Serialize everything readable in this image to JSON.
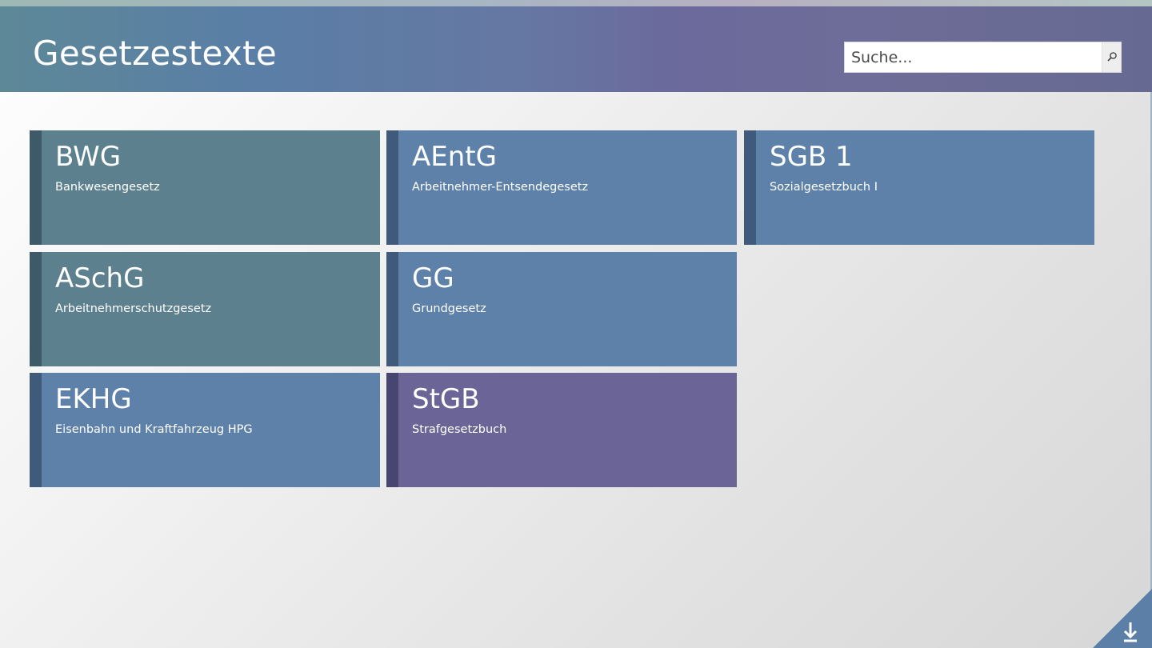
{
  "header": {
    "title": "Gesetzestexte",
    "search_placeholder": "Suche...",
    "search_icon": "magnifier-icon"
  },
  "tiles": [
    {
      "abbr": "BWG",
      "name": "Bankwesengesetz",
      "color": "teal"
    },
    {
      "abbr": "AEntG",
      "name": "Arbeitnehmer-Entsendegesetz",
      "color": "blue"
    },
    {
      "abbr": "SGB 1",
      "name": "Sozialgesetzbuch I",
      "color": "blue"
    },
    {
      "abbr": "ASchG",
      "name": "Arbeitnehmerschutzgesetz",
      "color": "teal"
    },
    {
      "abbr": "GG",
      "name": "Grundgesetz",
      "color": "blue"
    },
    {
      "abbr": "EKHG",
      "name": "Eisenbahn und Kraftfahrzeug HPG",
      "color": "blue"
    },
    {
      "abbr": "StGB",
      "name": "Strafgesetzbuch",
      "color": "purple"
    }
  ],
  "colors": {
    "teal": "#5d808e",
    "blue": "#5e81a9",
    "purple": "#6a6596",
    "corner": "#5b7fa6"
  },
  "corner": {
    "icon": "download-icon"
  }
}
